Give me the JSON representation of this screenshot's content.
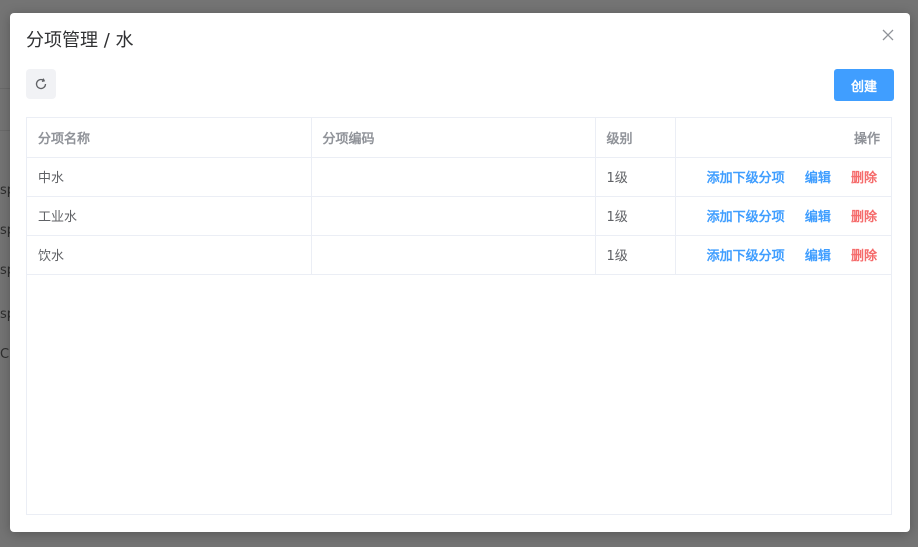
{
  "modal": {
    "title": "分项管理 / 水",
    "create_label": "创建"
  },
  "background": {
    "fragments": [
      "sp",
      "sp",
      "sp",
      "sp",
      "C"
    ]
  },
  "table": {
    "columns": [
      "分项名称",
      "分项编码",
      "级别",
      "操作"
    ],
    "rows": [
      {
        "name": "中水",
        "code": "",
        "level": "1级"
      },
      {
        "name": "工业水",
        "code": "",
        "level": "1级"
      },
      {
        "name": "饮水",
        "code": "",
        "level": "1级"
      }
    ],
    "actions": {
      "add_child": "添加下级分项",
      "edit": "编辑",
      "delete": "删除"
    }
  },
  "icons": {
    "close": "close-icon",
    "refresh": "refresh-icon"
  },
  "colors": {
    "primary": "#409eff",
    "danger": "#f56c6c",
    "overlay": "#747474"
  }
}
